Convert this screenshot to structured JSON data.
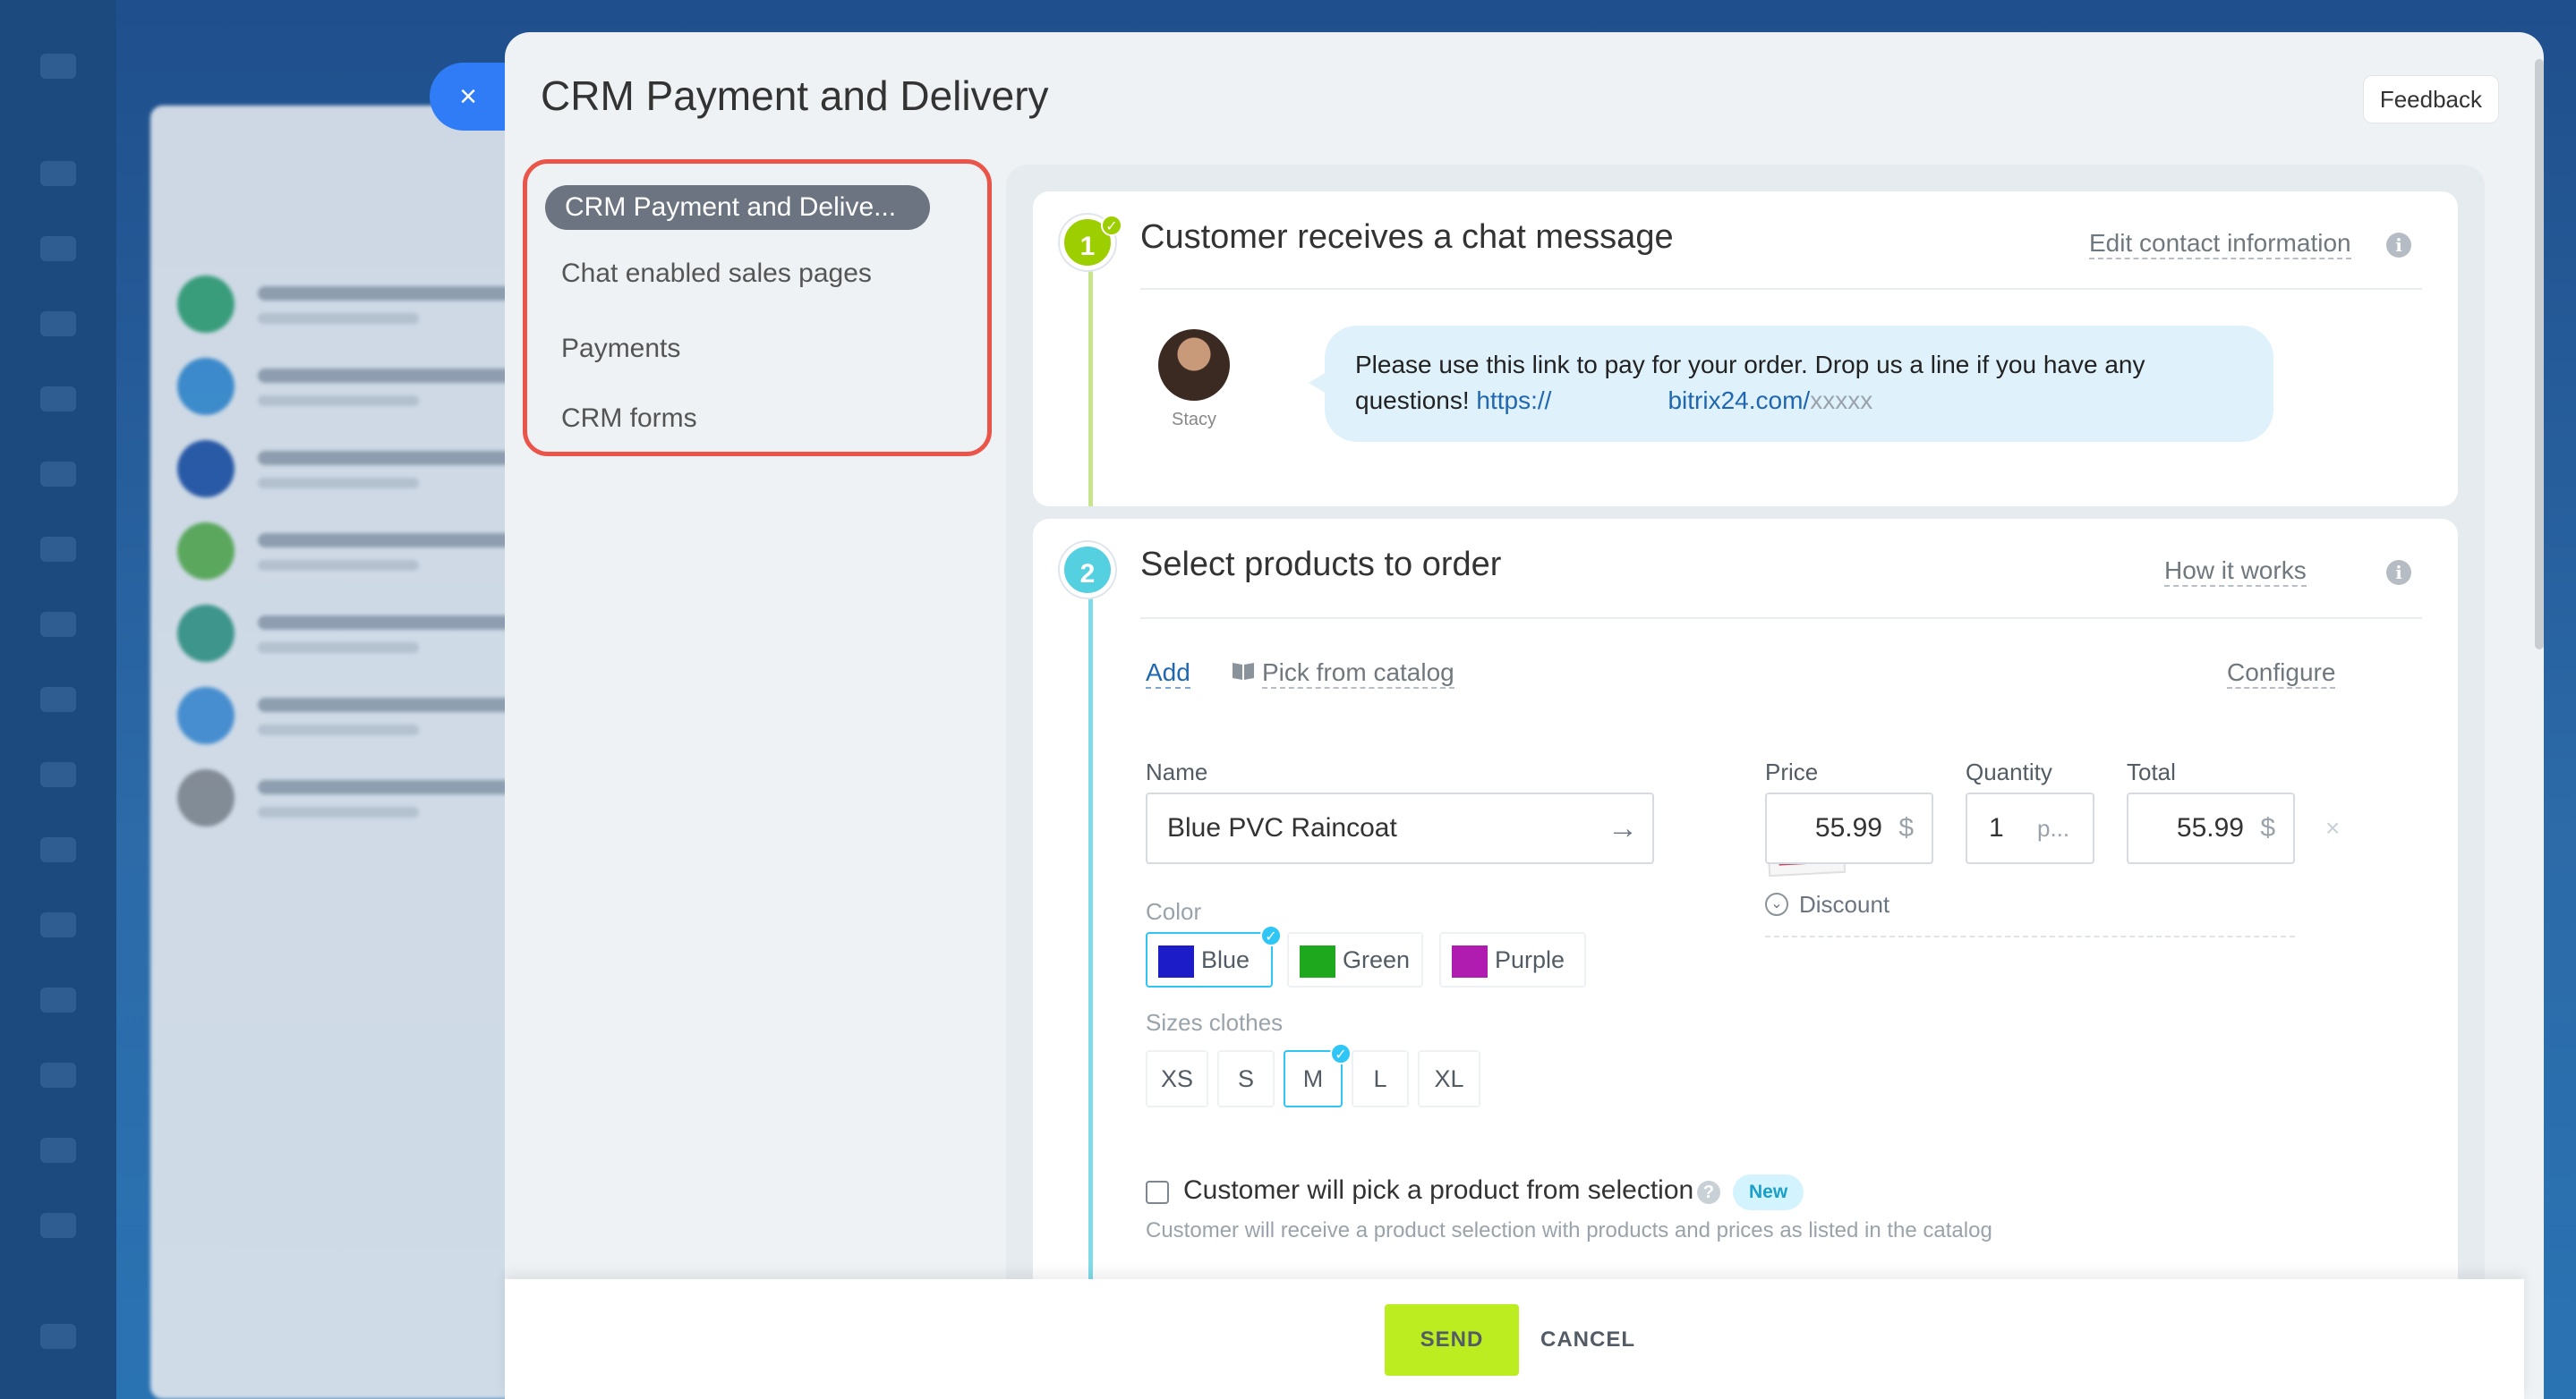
{
  "slider": {
    "title": "CRM Payment and Delivery",
    "feedback_label": "Feedback",
    "close_icon": "×"
  },
  "leftnav": {
    "items": [
      {
        "label": "CRM Payment and Delive...",
        "active": true
      },
      {
        "label": "Chat enabled sales pages"
      },
      {
        "label": "Payments"
      },
      {
        "label": "CRM forms"
      }
    ]
  },
  "step1": {
    "number": "1",
    "title": "Customer receives a chat message",
    "edit_contact_label": "Edit contact information",
    "info_icon": "i",
    "avatar_name": "Stacy",
    "message_text": "Please use this link to pay for your order. Drop us a line if you have any questions! ",
    "link_prefix": "https://",
    "link_domain": "bitrix24.com/",
    "link_suffix": "xxxxx"
  },
  "step2": {
    "number": "2",
    "title": "Select products to order",
    "how_it_works_label": "How it works",
    "add_label": "Add",
    "pick_catalog_label": "Pick from catalog",
    "configure_label": "Configure",
    "name_label": "Name",
    "name_value": "Blue PVC Raincoat",
    "price_label": "Price",
    "price_value": "55.99",
    "currency": "$",
    "quantity_label": "Quantity",
    "quantity_value": "1",
    "quantity_unit": "p...",
    "total_label": "Total",
    "total_value": "55.99",
    "discount_label": "Discount",
    "color_label": "Color",
    "colors": [
      {
        "name": "Blue",
        "hex": "#1c1cc8",
        "selected": true
      },
      {
        "name": "Green",
        "hex": "#1ea81e",
        "selected": false
      },
      {
        "name": "Purple",
        "hex": "#b01cb0",
        "selected": false
      }
    ],
    "sizes_label": "Sizes clothes",
    "sizes": [
      {
        "name": "XS",
        "selected": false
      },
      {
        "name": "S",
        "selected": false
      },
      {
        "name": "M",
        "selected": true
      },
      {
        "name": "L",
        "selected": false
      },
      {
        "name": "XL",
        "selected": false
      }
    ],
    "pick_selection_label": "Customer will pick a product from selection",
    "new_badge": "New",
    "pick_selection_hint": "Customer will receive a product selection with products and prices as listed in the catalog"
  },
  "footer": {
    "send_label": "SEND",
    "cancel_label": "CANCEL"
  },
  "colors": {
    "step1": "#9dcf00",
    "step2": "#55d0e0",
    "accent": "#2fc6f6",
    "send": "#bbed21",
    "highlight_frame": "#ea5449"
  }
}
